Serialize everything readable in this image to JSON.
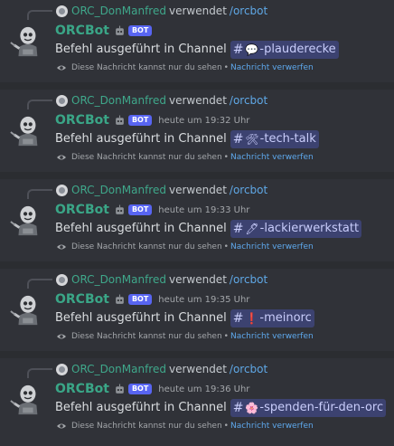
{
  "messages": [
    {
      "reply": {
        "user": "ORC_DonManfred",
        "verb": "verwendet",
        "command": "/orcbot"
      },
      "author": "ORCBot",
      "bot_badge": "BOT",
      "timestamp": "",
      "text": "Befehl ausgeführt in Channel",
      "channel": {
        "emoji": "💬",
        "name": "-plauderecke"
      },
      "ephemeral": {
        "note": "Diese Nachricht kannst nur du sehen",
        "separator": "•",
        "action": "Nachricht verwerfen"
      }
    },
    {
      "reply": {
        "user": "ORC_DonManfred",
        "verb": "verwendet",
        "command": "/orcbot"
      },
      "author": "ORCBot",
      "bot_badge": "BOT",
      "timestamp": "heute um 19:32 Uhr",
      "text": "Befehl ausgeführt in Channel",
      "channel": {
        "emoji": "🛠",
        "name": "-tech-talk"
      },
      "ephemeral": {
        "note": "Diese Nachricht kannst nur du sehen",
        "separator": "•",
        "action": "Nachricht verwerfen"
      }
    },
    {
      "reply": {
        "user": "ORC_DonManfred",
        "verb": "verwendet",
        "command": "/orcbot"
      },
      "author": "ORCBot",
      "bot_badge": "BOT",
      "timestamp": "heute um 19:33 Uhr",
      "text": "Befehl ausgeführt in Channel",
      "channel": {
        "emoji": "🖊",
        "name": "-lackierwerkstatt"
      },
      "ephemeral": {
        "note": "Diese Nachricht kannst nur du sehen",
        "separator": "•",
        "action": "Nachricht verwerfen"
      }
    },
    {
      "reply": {
        "user": "ORC_DonManfred",
        "verb": "verwendet",
        "command": "/orcbot"
      },
      "author": "ORCBot",
      "bot_badge": "BOT",
      "timestamp": "heute um 19:35 Uhr",
      "text": "Befehl ausgeführt in Channel",
      "channel": {
        "emoji": "❗",
        "name": "-meinorc"
      },
      "ephemeral": {
        "note": "Diese Nachricht kannst nur du sehen",
        "separator": "•",
        "action": "Nachricht verwerfen"
      }
    },
    {
      "reply": {
        "user": "ORC_DonManfred",
        "verb": "verwendet",
        "command": "/orcbot"
      },
      "author": "ORCBot",
      "bot_badge": "BOT",
      "timestamp": "heute um 19:36 Uhr",
      "text": "Befehl ausgeführt in Channel",
      "channel": {
        "emoji": "🌸",
        "name": "-spenden-für-den-orc"
      },
      "ephemeral": {
        "note": "Diese Nachricht kannst nur du sehen",
        "separator": "•",
        "action": "Nachricht verwerfen"
      }
    }
  ],
  "colors": {
    "background": "#2b2d31",
    "message_bg": "#303238",
    "author": "#3aa687",
    "link": "#5ea8ec",
    "mention_bg": "#3c4270",
    "badge": "#5865f2"
  }
}
